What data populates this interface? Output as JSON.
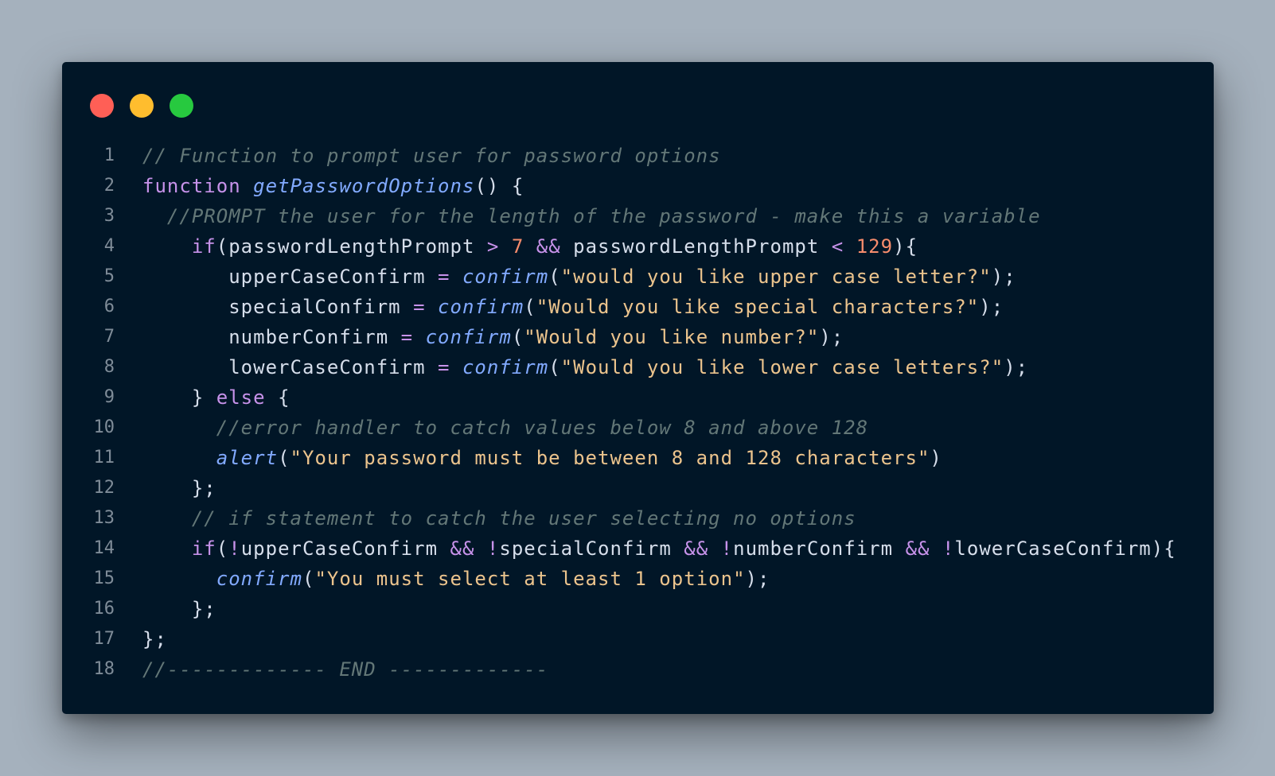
{
  "window": {
    "controls": [
      {
        "name": "close",
        "color": "#ff5f56"
      },
      {
        "name": "minimize",
        "color": "#ffbd2e"
      },
      {
        "name": "maximize",
        "color": "#27c93f"
      }
    ]
  },
  "theme": {
    "background": "#011627",
    "page_background": "#a5b1bd",
    "comment": "#637777",
    "keyword": "#c792ea",
    "function": "#82aaff",
    "string": "#ecc48d",
    "number": "#f78c6c",
    "plain": "#d6deeb",
    "line_number": "#7f8c98"
  },
  "code": {
    "language": "javascript",
    "lines": [
      {
        "number": "1",
        "tokens": [
          {
            "t": "comment",
            "v": "// Function to prompt user for password options"
          }
        ]
      },
      {
        "number": "2",
        "tokens": [
          {
            "t": "keyword",
            "v": "function"
          },
          {
            "t": "plain",
            "v": " "
          },
          {
            "t": "func",
            "v": "getPasswordOptions"
          },
          {
            "t": "plain",
            "v": "() {"
          }
        ]
      },
      {
        "number": "3",
        "tokens": [
          {
            "t": "plain",
            "v": "  "
          },
          {
            "t": "comment",
            "v": "//PROMPT the user for the length of the password - make this a variable"
          }
        ]
      },
      {
        "number": "4",
        "tokens": [
          {
            "t": "plain",
            "v": "    "
          },
          {
            "t": "keyword",
            "v": "if"
          },
          {
            "t": "plain",
            "v": "(passwordLengthPrompt "
          },
          {
            "t": "operator",
            "v": ">"
          },
          {
            "t": "plain",
            "v": " "
          },
          {
            "t": "number",
            "v": "7"
          },
          {
            "t": "plain",
            "v": " "
          },
          {
            "t": "operator",
            "v": "&&"
          },
          {
            "t": "plain",
            "v": " passwordLengthPrompt "
          },
          {
            "t": "operator",
            "v": "<"
          },
          {
            "t": "plain",
            "v": " "
          },
          {
            "t": "number",
            "v": "129"
          },
          {
            "t": "plain",
            "v": "){"
          }
        ]
      },
      {
        "number": "5",
        "tokens": [
          {
            "t": "plain",
            "v": "       upperCaseConfirm "
          },
          {
            "t": "operator",
            "v": "="
          },
          {
            "t": "plain",
            "v": " "
          },
          {
            "t": "func",
            "v": "confirm"
          },
          {
            "t": "plain",
            "v": "("
          },
          {
            "t": "string",
            "v": "\"would you like upper case letter?\""
          },
          {
            "t": "plain",
            "v": ");"
          }
        ]
      },
      {
        "number": "6",
        "tokens": [
          {
            "t": "plain",
            "v": "       specialConfirm "
          },
          {
            "t": "operator",
            "v": "="
          },
          {
            "t": "plain",
            "v": " "
          },
          {
            "t": "func",
            "v": "confirm"
          },
          {
            "t": "plain",
            "v": "("
          },
          {
            "t": "string",
            "v": "\"Would you like special characters?\""
          },
          {
            "t": "plain",
            "v": ");"
          }
        ]
      },
      {
        "number": "7",
        "tokens": [
          {
            "t": "plain",
            "v": "       numberConfirm "
          },
          {
            "t": "operator",
            "v": "="
          },
          {
            "t": "plain",
            "v": " "
          },
          {
            "t": "func",
            "v": "confirm"
          },
          {
            "t": "plain",
            "v": "("
          },
          {
            "t": "string",
            "v": "\"Would you like number?\""
          },
          {
            "t": "plain",
            "v": ");"
          }
        ]
      },
      {
        "number": "8",
        "tokens": [
          {
            "t": "plain",
            "v": "       lowerCaseConfirm "
          },
          {
            "t": "operator",
            "v": "="
          },
          {
            "t": "plain",
            "v": " "
          },
          {
            "t": "func",
            "v": "confirm"
          },
          {
            "t": "plain",
            "v": "("
          },
          {
            "t": "string",
            "v": "\"Would you like lower case letters?\""
          },
          {
            "t": "plain",
            "v": ");"
          }
        ]
      },
      {
        "number": "9",
        "tokens": [
          {
            "t": "plain",
            "v": "    } "
          },
          {
            "t": "keyword",
            "v": "else"
          },
          {
            "t": "plain",
            "v": " {"
          }
        ]
      },
      {
        "number": "10",
        "tokens": [
          {
            "t": "plain",
            "v": "      "
          },
          {
            "t": "comment",
            "v": "//error handler to catch values below 8 and above 128"
          }
        ]
      },
      {
        "number": "11",
        "tokens": [
          {
            "t": "plain",
            "v": "      "
          },
          {
            "t": "func",
            "v": "alert"
          },
          {
            "t": "plain",
            "v": "("
          },
          {
            "t": "string",
            "v": "\"Your password must be between 8 and 128 characters\""
          },
          {
            "t": "plain",
            "v": ")"
          }
        ]
      },
      {
        "number": "12",
        "tokens": [
          {
            "t": "plain",
            "v": "    };"
          }
        ]
      },
      {
        "number": "13",
        "tokens": [
          {
            "t": "plain",
            "v": "    "
          },
          {
            "t": "comment",
            "v": "// if statement to catch the user selecting no options"
          }
        ]
      },
      {
        "number": "14",
        "tokens": [
          {
            "t": "plain",
            "v": "    "
          },
          {
            "t": "keyword",
            "v": "if"
          },
          {
            "t": "plain",
            "v": "("
          },
          {
            "t": "operator",
            "v": "!"
          },
          {
            "t": "plain",
            "v": "upperCaseConfirm "
          },
          {
            "t": "operator",
            "v": "&&"
          },
          {
            "t": "plain",
            "v": " "
          },
          {
            "t": "operator",
            "v": "!"
          },
          {
            "t": "plain",
            "v": "specialConfirm "
          },
          {
            "t": "operator",
            "v": "&&"
          },
          {
            "t": "plain",
            "v": " "
          },
          {
            "t": "operator",
            "v": "!"
          },
          {
            "t": "plain",
            "v": "numberConfirm "
          },
          {
            "t": "operator",
            "v": "&&"
          },
          {
            "t": "plain",
            "v": " "
          },
          {
            "t": "operator",
            "v": "!"
          },
          {
            "t": "plain",
            "v": "lowerCaseConfirm){"
          }
        ]
      },
      {
        "number": "15",
        "tokens": [
          {
            "t": "plain",
            "v": "      "
          },
          {
            "t": "func",
            "v": "confirm"
          },
          {
            "t": "plain",
            "v": "("
          },
          {
            "t": "string",
            "v": "\"You must select at least 1 option\""
          },
          {
            "t": "plain",
            "v": ");"
          }
        ]
      },
      {
        "number": "16",
        "tokens": [
          {
            "t": "plain",
            "v": "    };"
          }
        ]
      },
      {
        "number": "17",
        "tokens": [
          {
            "t": "plain",
            "v": "};"
          }
        ]
      },
      {
        "number": "18",
        "tokens": [
          {
            "t": "comment",
            "v": "//------------- END -------------"
          }
        ]
      }
    ]
  }
}
